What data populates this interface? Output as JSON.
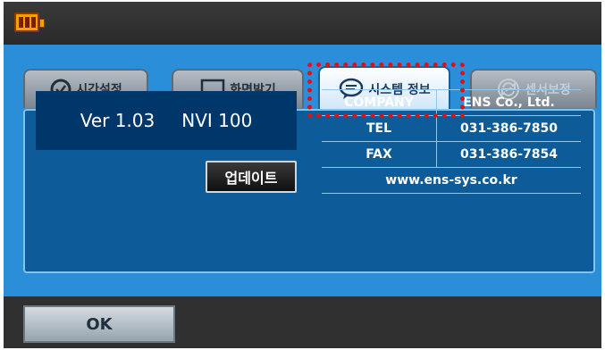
{
  "tabs": [
    {
      "label": "시간설정",
      "icon": "clock-icon"
    },
    {
      "label": "화면밝기",
      "icon": "monitor-icon"
    },
    {
      "label": "시스템 정보",
      "icon": "speech-bubble-icon"
    },
    {
      "label": "센서보정",
      "icon": "refresh-icon"
    }
  ],
  "active_tab": "시스템 정보",
  "system_info": {
    "version": "Ver 1.03",
    "model": "NVI 100",
    "update_label": "업데이트"
  },
  "company_table": [
    {
      "key": "COMPANY",
      "value": "ENS Co., Ltd."
    },
    {
      "key": "TEL",
      "value": "031-386-7850"
    },
    {
      "key": "FAX",
      "value": "031-386-7854"
    }
  ],
  "website": "www.ens-sys.co.kr",
  "ok_label": "OK",
  "colors": {
    "panel": "#0d5c99",
    "background": "#2a8fd8",
    "highlight": "#e01010",
    "battery": "#f5a000"
  },
  "status": {
    "battery_icon": "battery-icon"
  }
}
